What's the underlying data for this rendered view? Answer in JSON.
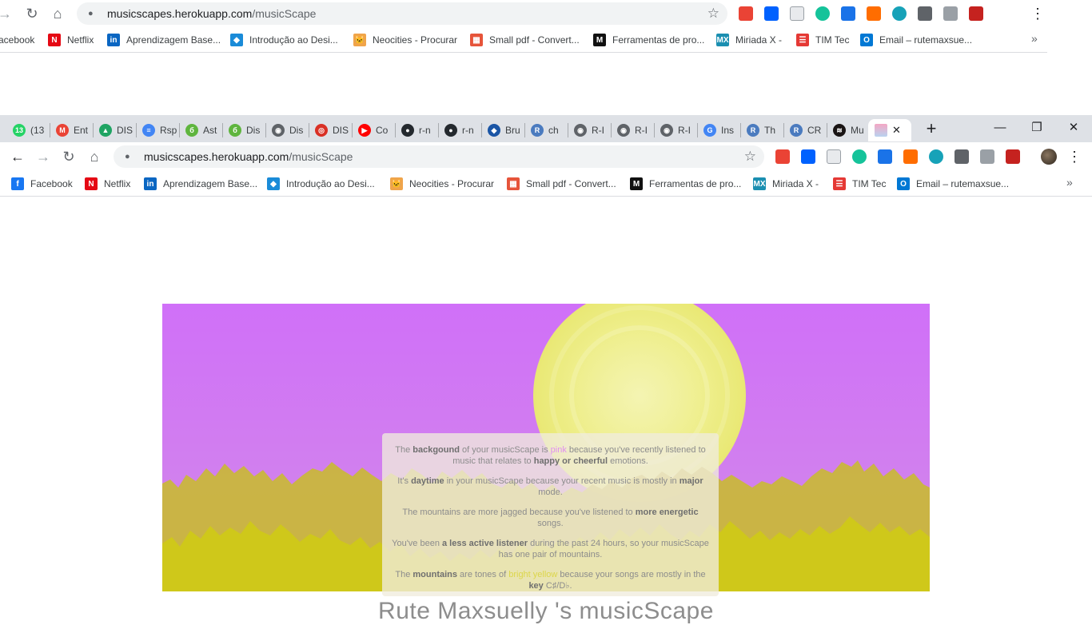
{
  "ghost": {
    "url_host": "musicscapes.herokuapp.com",
    "url_path": "/musicScape",
    "bookmarks": [
      "acebook",
      "Netflix",
      "Aprendizagem Base...",
      "Introdução ao Desi...",
      "Neocities - Procurar",
      "Small pdf - Convert...",
      "Ferramentas de pro...",
      "Miriada X -",
      "TIM Tec",
      "Email – rutemaxsue..."
    ],
    "more_label": "»"
  },
  "tabs": [
    {
      "label": "(13",
      "fav": "13",
      "color": "#25d366"
    },
    {
      "label": "Ent",
      "fav": "M",
      "color": "#ea4335"
    },
    {
      "label": "DIS",
      "fav": "▲",
      "color": "#1fa463"
    },
    {
      "label": "Rsp",
      "fav": "≡",
      "color": "#4285f4"
    },
    {
      "label": "Ast",
      "fav": "б",
      "color": "#5fb53e"
    },
    {
      "label": "Dis",
      "fav": "б",
      "color": "#5fb53e"
    },
    {
      "label": "Dis",
      "fav": "◉",
      "color": "#5f6368"
    },
    {
      "label": "DIS",
      "fav": "◎",
      "color": "#d93025"
    },
    {
      "label": "Co",
      "fav": "▶",
      "color": "#ff0000"
    },
    {
      "label": "r-n",
      "fav": "●",
      "color": "#24292e"
    },
    {
      "label": "r-n",
      "fav": "●",
      "color": "#24292e"
    },
    {
      "label": "Bru",
      "fav": "◆",
      "color": "#1a55a5"
    },
    {
      "label": "ch",
      "fav": "R",
      "color": "#4b7bbf"
    },
    {
      "label": "R-I",
      "fav": "◉",
      "color": "#5f6368"
    },
    {
      "label": "R-I",
      "fav": "◉",
      "color": "#5f6368"
    },
    {
      "label": "R-I",
      "fav": "◉",
      "color": "#5f6368"
    },
    {
      "label": "Ins",
      "fav": "G",
      "color": "#4285f4"
    },
    {
      "label": "Th",
      "fav": "R",
      "color": "#4b7bbf"
    },
    {
      "label": "CR",
      "fav": "R",
      "color": "#4b7bbf"
    },
    {
      "label": "Mu",
      "fav": "≋",
      "color": "#191414"
    }
  ],
  "active_tab": {
    "close": "✕"
  },
  "new_tab": "+",
  "window": {
    "minimize": "—",
    "restore": "❐",
    "close": "✕"
  },
  "toolbar": {
    "back": "←",
    "forward": "→",
    "reload": "↻",
    "home": "⌂",
    "lock": "🔒",
    "url_host": "musicscapes.herokuapp.com",
    "url_path": "/musicScape",
    "star": "☆",
    "menu": "⋮"
  },
  "bookmarks": [
    {
      "label": "Facebook",
      "fav": "f",
      "color": "#1877f2"
    },
    {
      "label": "Netflix",
      "fav": "N",
      "color": "#e50914"
    },
    {
      "label": "Aprendizagem Base...",
      "fav": "in",
      "color": "#0a66c2"
    },
    {
      "label": "Introdução ao Desi...",
      "fav": "◆",
      "color": "#1a8bd8"
    },
    {
      "label": "Neocities - Procurar",
      "fav": "🐱",
      "color": "#f0a44a"
    },
    {
      "label": "Small pdf - Convert...",
      "fav": "▦",
      "color": "#e6543a"
    },
    {
      "label": "Ferramentas de pro...",
      "fav": "M",
      "color": "#111111"
    },
    {
      "label": "Miriada X -",
      "fav": "MX",
      "color": "#1b8fb1"
    },
    {
      "label": "TIM Tec",
      "fav": "☰",
      "color": "#e53935"
    },
    {
      "label": "Email – rutemaxsue...",
      "fav": "O",
      "color": "#0078d4"
    }
  ],
  "bookmarks_more": "»",
  "card": {
    "p1_a": "The ",
    "p1_b": "backgound",
    "p1_c": " of your musicScape is ",
    "p1_d": "pink",
    "p1_e": " because you've recently listened to music that relates to ",
    "p1_f": "happy or cheerful",
    "p1_g": " emotions.",
    "p2_a": "It's ",
    "p2_b": "daytime",
    "p2_c": " in your musicScape because your recent music is mostly in ",
    "p2_d": "major",
    "p2_e": " mode.",
    "p3_a": "The mountains are more jagged because you've listened to ",
    "p3_b": "more energetic",
    "p3_c": " songs.",
    "p4_a": "You've been ",
    "p4_b": "a less active listener",
    "p4_c": " during the past 24 hours, so your musicScape has one pair of mountains.",
    "p5_a": "The ",
    "p5_b": "mountains",
    "p5_c": " are tones of ",
    "p5_d": "bright yellow",
    "p5_e": " because your songs are mostly in the ",
    "p5_f": "key",
    "p5_g": " C♯/D♭."
  },
  "scape_title": "Rute Maxsuelly 's musicScape",
  "colors": {
    "sky": "#d070f8",
    "sun": "#eded78",
    "mountain_back": "#c9b63c",
    "mountain_front": "#cfc81a"
  }
}
